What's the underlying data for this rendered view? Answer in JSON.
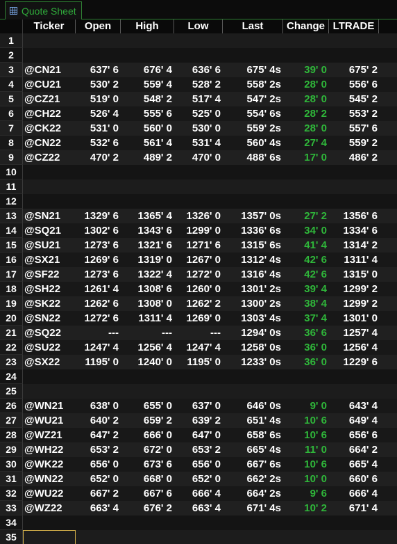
{
  "tab": {
    "label": "Quote Sheet",
    "icon": "spreadsheet-icon"
  },
  "columns": [
    "Ticker",
    "Open",
    "High",
    "Low",
    "Last",
    "Change",
    "LTRADE"
  ],
  "colors": {
    "change_positive": "#2fb73a",
    "tab_accent": "#2e7d32"
  },
  "rows": [
    {
      "num": "1",
      "cells": [
        "",
        "",
        "",
        "",
        "",
        "",
        ""
      ]
    },
    {
      "num": "2",
      "cells": [
        "",
        "",
        "",
        "",
        "",
        "",
        ""
      ]
    },
    {
      "num": "3",
      "cells": [
        "@CN21",
        "637' 6",
        "676' 4",
        "636' 6",
        "675' 4s",
        "39' 0",
        "675' 2"
      ]
    },
    {
      "num": "4",
      "cells": [
        "@CU21",
        "530' 2",
        "559' 4",
        "528' 2",
        "558' 2s",
        "28' 0",
        "556' 6"
      ]
    },
    {
      "num": "5",
      "cells": [
        "@CZ21",
        "519' 0",
        "548' 2",
        "517' 4",
        "547' 2s",
        "28' 0",
        "545' 2"
      ]
    },
    {
      "num": "6",
      "cells": [
        "@CH22",
        "526' 4",
        "555' 6",
        "525' 0",
        "554' 6s",
        "28' 2",
        "553' 2"
      ]
    },
    {
      "num": "7",
      "cells": [
        "@CK22",
        "531' 0",
        "560' 0",
        "530' 0",
        "559' 2s",
        "28' 0",
        "557' 6"
      ]
    },
    {
      "num": "8",
      "cells": [
        "@CN22",
        "532' 6",
        "561' 4",
        "531' 4",
        "560' 4s",
        "27' 4",
        "559' 2"
      ]
    },
    {
      "num": "9",
      "cells": [
        "@CZ22",
        "470' 2",
        "489' 2",
        "470' 0",
        "488' 6s",
        "17' 0",
        "486' 2"
      ]
    },
    {
      "num": "10",
      "cells": [
        "",
        "",
        "",
        "",
        "",
        "",
        ""
      ]
    },
    {
      "num": "11",
      "cells": [
        "",
        "",
        "",
        "",
        "",
        "",
        ""
      ]
    },
    {
      "num": "12",
      "cells": [
        "",
        "",
        "",
        "",
        "",
        "",
        ""
      ]
    },
    {
      "num": "13",
      "cells": [
        "@SN21",
        "1329' 6",
        "1365' 4",
        "1326' 0",
        "1357' 0s",
        "27' 2",
        "1356' 6"
      ]
    },
    {
      "num": "14",
      "cells": [
        "@SQ21",
        "1302' 6",
        "1343' 6",
        "1299' 0",
        "1336' 6s",
        "34' 0",
        "1334' 6"
      ]
    },
    {
      "num": "15",
      "cells": [
        "@SU21",
        "1273' 6",
        "1321' 6",
        "1271' 6",
        "1315' 6s",
        "41' 4",
        "1314' 2"
      ]
    },
    {
      "num": "16",
      "cells": [
        "@SX21",
        "1269' 6",
        "1319' 0",
        "1267' 0",
        "1312' 4s",
        "42' 6",
        "1311' 4"
      ]
    },
    {
      "num": "17",
      "cells": [
        "@SF22",
        "1273' 6",
        "1322' 4",
        "1272' 0",
        "1316' 4s",
        "42' 6",
        "1315' 0"
      ]
    },
    {
      "num": "18",
      "cells": [
        "@SH22",
        "1261' 4",
        "1308' 6",
        "1260' 0",
        "1301' 2s",
        "39' 4",
        "1299' 2"
      ]
    },
    {
      "num": "19",
      "cells": [
        "@SK22",
        "1262' 6",
        "1308' 0",
        "1262' 2",
        "1300' 2s",
        "38' 4",
        "1299' 2"
      ]
    },
    {
      "num": "20",
      "cells": [
        "@SN22",
        "1272' 6",
        "1311' 4",
        "1269' 0",
        "1303' 4s",
        "37' 4",
        "1301' 0"
      ]
    },
    {
      "num": "21",
      "cells": [
        "@SQ22",
        "---",
        "---",
        "---",
        "1294' 0s",
        "36' 6",
        "1257' 4"
      ]
    },
    {
      "num": "22",
      "cells": [
        "@SU22",
        "1247' 4",
        "1256' 4",
        "1247' 4",
        "1258' 0s",
        "36' 0",
        "1256' 4"
      ]
    },
    {
      "num": "23",
      "cells": [
        "@SX22",
        "1195' 0",
        "1240' 0",
        "1195' 0",
        "1233' 0s",
        "36' 0",
        "1229' 6"
      ]
    },
    {
      "num": "24",
      "cells": [
        "",
        "",
        "",
        "",
        "",
        "",
        ""
      ]
    },
    {
      "num": "25",
      "cells": [
        "",
        "",
        "",
        "",
        "",
        "",
        ""
      ]
    },
    {
      "num": "26",
      "cells": [
        "@WN21",
        "638' 0",
        "655' 0",
        "637' 0",
        "646' 0s",
        "9' 0",
        "643' 4"
      ]
    },
    {
      "num": "27",
      "cells": [
        "@WU21",
        "640' 2",
        "659' 2",
        "639' 2",
        "651' 4s",
        "10' 6",
        "649' 4"
      ]
    },
    {
      "num": "28",
      "cells": [
        "@WZ21",
        "647' 2",
        "666' 0",
        "647' 0",
        "658' 6s",
        "10' 6",
        "656' 6"
      ]
    },
    {
      "num": "29",
      "cells": [
        "@WH22",
        "653' 2",
        "672' 0",
        "653' 2",
        "665' 4s",
        "11' 0",
        "664' 2"
      ]
    },
    {
      "num": "30",
      "cells": [
        "@WK22",
        "656' 0",
        "673' 6",
        "656' 0",
        "667' 6s",
        "10' 6",
        "665' 4"
      ]
    },
    {
      "num": "31",
      "cells": [
        "@WN22",
        "652' 0",
        "668' 0",
        "652' 0",
        "662' 2s",
        "10' 0",
        "660' 6"
      ]
    },
    {
      "num": "32",
      "cells": [
        "@WU22",
        "667' 2",
        "667' 6",
        "666' 4",
        "664' 2s",
        "9' 6",
        "666' 4"
      ]
    },
    {
      "num": "33",
      "cells": [
        "@WZ22",
        "663' 4",
        "676' 2",
        "663' 4",
        "671' 4s",
        "10' 2",
        "671' 4"
      ]
    },
    {
      "num": "34",
      "cells": [
        "",
        "",
        "",
        "",
        "",
        "",
        ""
      ]
    },
    {
      "num": "35",
      "cells": [
        "",
        "",
        "",
        "",
        "",
        "",
        ""
      ]
    }
  ]
}
